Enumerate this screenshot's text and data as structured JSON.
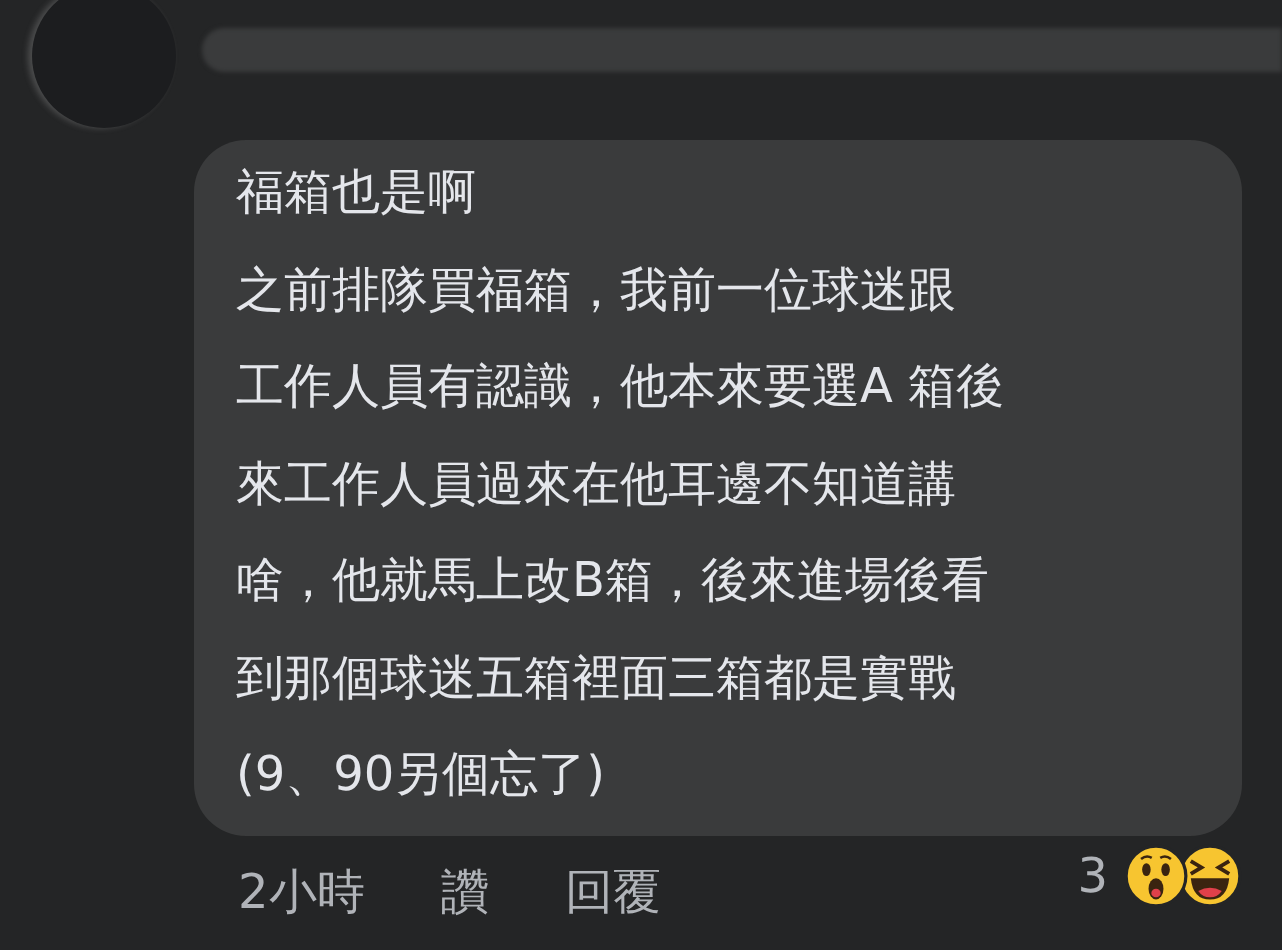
{
  "comment": {
    "lines": [
      "福箱也是啊",
      "之前排隊買福箱，我前一位球迷跟",
      "工作人員有認識，他本來要選A 箱後",
      "來工作人員過來在他耳邊不知道講",
      "啥，他就馬上改B箱，後來進場後看",
      "到那個球迷五箱裡面三箱都是實戰",
      "(9、90另個忘了)"
    ]
  },
  "actions": [
    "2小時",
    "讚",
    "回覆"
  ],
  "reactions": {
    "count": "3",
    "emojis": [
      {
        "kind": "wow"
      },
      {
        "kind": "haha"
      }
    ]
  }
}
